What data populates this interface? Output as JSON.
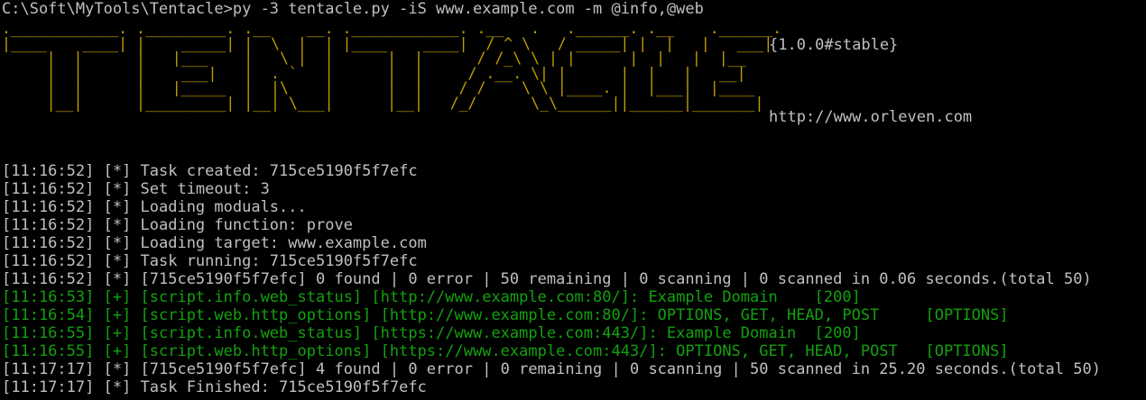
{
  "command_line": "C:\\Soft\\MyTools\\Tentacle>py -3 tentacle.py -iS www.example.com -m @info,@web",
  "banner_art": [
    ".____________. ._________. .__    __. .____________. .__   .   .______. .__    .______. ",
    "|____    ____| |    _____| |  \\  |  | |____    ____|  / ^ \\   / _____| |  |   |   ___| ",
    "     |  |      |   |___    |   \\ |  |      |  |      / /_\\ \\ | |      |  |   |  |__   ",
    "     |  |      |    ___|   |  . `   |      |  |     / .__. \\| |      |  |   |   __|  ",
    "     |  |      |   |_____  |  |\\    |      |  |    / /    \\ \\ |____. |  |___|  |____ ",
    "     |__|      |_________| |__| \\___|      |__|   /_/      \\_\\______||______|_______| "
  ],
  "version_tag": "{1.0.0#stable}",
  "site_url": "http://www.orleven.com",
  "log_lines": [
    {
      "text": "[11:16:52] [*] Task created: 715ce5190f5f7efc",
      "color": "#c0c0c0"
    },
    {
      "text": "[11:16:52] [*] Set timeout: 3",
      "color": "#c0c0c0"
    },
    {
      "text": "[11:16:52] [*] Loading moduals...",
      "color": "#c0c0c0"
    },
    {
      "text": "[11:16:52] [*] Loading function: prove",
      "color": "#c0c0c0"
    },
    {
      "text": "[11:16:52] [*] Loading target: www.example.com",
      "color": "#c0c0c0"
    },
    {
      "text": "[11:16:52] [*] Task running: 715ce5190f5f7efc",
      "color": "#c0c0c0"
    },
    {
      "text": "[11:16:52] [*] [715ce5190f5f7efc] 0 found | 0 error | 50 remaining | 0 scanning | 0 scanned in 0.06 seconds.(total 50)",
      "color": "#c0c0c0"
    },
    {
      "text": "[11:16:53] [+] [script.info.web_status] [http://www.example.com:80/]: Example Domain    [200]",
      "color": "#13a10e"
    },
    {
      "text": "[11:16:54] [+] [script.web.http_options] [http://www.example.com:80/]: OPTIONS, GET, HEAD, POST     [OPTIONS]",
      "color": "#13a10e"
    },
    {
      "text": "[11:16:55] [+] [script.info.web_status] [https://www.example.com:443/]: Example Domain  [200]",
      "color": "#13a10e"
    },
    {
      "text": "[11:16:55] [+] [script.web.http_options] [https://www.example.com:443/]: OPTIONS, GET, HEAD, POST   [OPTIONS]",
      "color": "#13a10e"
    },
    {
      "text": "[11:17:17] [*] [715ce5190f5f7efc] 4 found | 0 error | 0 remaining | 0 scanning | 50 scanned in 25.20 seconds.(total 50)",
      "color": "#c0c0c0"
    },
    {
      "text": "[11:17:17] [*] Task Finished: 715ce5190f5f7efc",
      "color": "#c0c0c0"
    }
  ],
  "colors": {
    "background": "#000000",
    "default_text": "#c0c0c0",
    "success_text": "#13a10e",
    "banner": "#c19c00"
  }
}
